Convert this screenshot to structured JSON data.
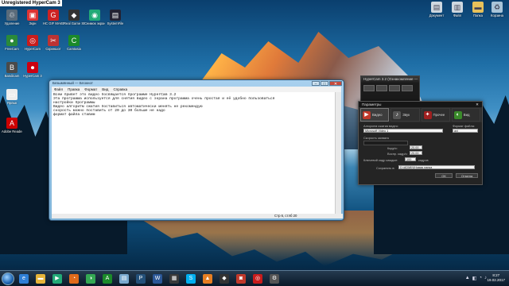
{
  "watermark": "Unregistered HyperCam 3",
  "desktop": {
    "icons_left": [
      {
        "label": "Удаление",
        "icon": "trash-icon",
        "color": "#5a6b7a",
        "glyph": "♲"
      },
      {
        "label": "Зкрн",
        "icon": "app-icon",
        "color": "#d33",
        "glyph": "▣"
      },
      {
        "label": "HC GIF MAKER",
        "icon": "gif-icon",
        "color": "#c22",
        "glyph": "G"
      },
      {
        "label": "Real Game Studio",
        "icon": "game-icon",
        "color": "#333",
        "glyph": "◆"
      },
      {
        "label": "Снимок экрана",
        "icon": "camera-icon",
        "color": "#2a7",
        "glyph": "◉"
      },
      {
        "label": "SystemFile",
        "icon": "file-icon",
        "color": "#223",
        "glyph": "▤"
      },
      {
        "label": "FreeCam",
        "icon": "freecam-icon",
        "color": "#2a8a3a",
        "glyph": "●"
      },
      {
        "label": "HyperCam",
        "icon": "hypercam-icon",
        "color": "#c81c1c",
        "glyph": "◎"
      },
      {
        "label": "Скриншот",
        "icon": "screenshot-icon",
        "color": "#b33",
        "glyph": "✂"
      },
      {
        "label": "Camtasia",
        "icon": "camtasia-icon",
        "color": "#1b8a2a",
        "glyph": "C"
      },
      {
        "label": "Bandicam",
        "icon": "bandicam-icon",
        "color": "#4a4a4a",
        "glyph": "B"
      },
      {
        "label": "HyperCam 3",
        "icon": "record-icon",
        "color": "#c01",
        "glyph": "⏺"
      },
      {
        "label": "Ярлык",
        "icon": "shortcut-icon",
        "color": "#eee",
        "glyph": "▭"
      },
      {
        "label": "Adobe Reader",
        "icon": "pdf-icon",
        "color": "#c00",
        "glyph": "A"
      }
    ],
    "icons_right": [
      {
        "label": "Документ",
        "icon": "document-icon",
        "color": "#cfd8e0",
        "glyph": "▤"
      },
      {
        "label": "Файл",
        "icon": "file-icon",
        "color": "#cfd8e0",
        "glyph": "▥"
      },
      {
        "label": "Папка",
        "icon": "folder-icon",
        "color": "#e8c15a",
        "glyph": "▬"
      },
      {
        "label": "Корзина",
        "icon": "recycle-bin-icon",
        "color": "#a9c4d8",
        "glyph": "♻"
      }
    ]
  },
  "notepad": {
    "title": "Безымянный — Блокнот",
    "menu": [
      "Файл",
      "Правка",
      "Формат",
      "Вид",
      "Справка"
    ],
    "text": "Всем привет это видео посвящается программе HyperCam 3.2\nЭта программа используется для снятия видео с экрана программа очень простая и её удобно пользоваться\nнастройки программы\nВидео алгоритм сжатия поставиться автоматически менять не рекомендую\nскорость можно поставить от 20 до 30 больше не надо\nформат файла ставим",
    "status": "Стр 6, стлб 20"
  },
  "hypercam": {
    "title": "HyperCam 3.2 (Ознакомление — ...)"
  },
  "params": {
    "title": "Параметры",
    "tabs": [
      {
        "label": "Видео",
        "icon": "video-icon",
        "color": "#c0392b",
        "glyph": "▶"
      },
      {
        "label": "Звук",
        "icon": "sound-icon",
        "color": "#555",
        "glyph": "♪"
      },
      {
        "label": "Прочее",
        "icon": "other-icon",
        "color": "#a02020",
        "glyph": "✦"
      },
      {
        "label": "Вид",
        "icon": "view-icon",
        "color": "#3a8a2a",
        "glyph": "◐"
      }
    ],
    "codec_label": "Алгоритм сжатия видео:",
    "codec_value": "Microsoft Video 1",
    "format_label": "Формат файла:",
    "format_value": "avi",
    "speed_label": "Скорость захвата",
    "fps_label": "Кадр/с:",
    "fps_value": "20.00",
    "play_label": "Воспр. кадр/с:",
    "play_value": "20.00",
    "key_label": "Ключевой кадр каждые:",
    "key_value": "100",
    "key_unit": "кадров",
    "save_label": "Сохранять в:",
    "save_value": "D:\\ADMIN\\Новая папка",
    "ok_label": "ОК",
    "cancel_label": "Отмена"
  },
  "taskbar": {
    "apps": [
      {
        "icon": "ie-icon",
        "color": "#2f7fd6",
        "glyph": "e"
      },
      {
        "icon": "explorer-icon",
        "color": "#e6b43a",
        "glyph": "▬"
      },
      {
        "icon": "media-player-icon",
        "color": "#2a7",
        "glyph": "▶"
      },
      {
        "icon": "firefox-icon",
        "color": "#e06a1a",
        "glyph": "◔"
      },
      {
        "icon": "chrome-icon",
        "color": "#34a853",
        "glyph": "◑"
      },
      {
        "icon": "camtasia-icon",
        "color": "#1b8a2a",
        "glyph": "A"
      },
      {
        "icon": "notepad-icon",
        "color": "#7aa9cf",
        "glyph": "▤"
      },
      {
        "icon": "photoshop-icon",
        "color": "#24517a",
        "glyph": "P"
      },
      {
        "icon": "word-icon",
        "color": "#2b5797",
        "glyph": "W"
      },
      {
        "icon": "app-icon",
        "color": "#3a3a3a",
        "glyph": "▦"
      },
      {
        "icon": "skype-icon",
        "color": "#00aff0",
        "glyph": "S"
      },
      {
        "icon": "vlc-icon",
        "color": "#e67e22",
        "glyph": "▲"
      },
      {
        "icon": "game-icon",
        "color": "#333",
        "glyph": "◆"
      },
      {
        "icon": "photo-icon",
        "color": "#c0392b",
        "glyph": "◙"
      },
      {
        "icon": "hypercam-icon",
        "color": "#c81c1c",
        "glyph": "◎"
      },
      {
        "icon": "settings-icon",
        "color": "#555",
        "glyph": "⚙"
      }
    ],
    "tray": [
      "▲",
      "◧",
      "◔",
      "♪"
    ],
    "time": "8:27",
    "date": "19.02.2017"
  }
}
